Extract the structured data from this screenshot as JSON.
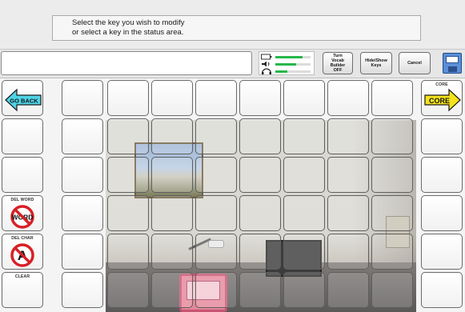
{
  "message": {
    "line1": "Select the key you wish to modify",
    "line2": "or select a key in the status area."
  },
  "status_bar": {
    "text_field_value": "",
    "meters": [
      {
        "icon": "battery-icon",
        "color": "#26b84a",
        "fill_fraction": 0.78
      },
      {
        "icon": "speaker-volume-icon",
        "color": "#26b84a",
        "fill_fraction": 0.6
      },
      {
        "icon": "headphones-icon",
        "color": "#26b84a",
        "fill_fraction": 0.35
      }
    ],
    "vocab_builder_button": [
      "Turn",
      "Vocab",
      "Builder",
      "OFF"
    ],
    "hide_show_keys_button": [
      "Hide/Show",
      "Keys"
    ],
    "cancel_button": "Cancel",
    "save_icon": "floppy-disk-icon"
  },
  "keys": {
    "go_back": {
      "label": "GO BACK",
      "arrow_color": "#4fd4e6",
      "direction": "left"
    },
    "core": {
      "caption": "CORE",
      "label": "CORE",
      "arrow_color": "#f5e21c",
      "direction": "right"
    },
    "del_word": {
      "caption": "DEL WORD",
      "symbol_text": "WORD"
    },
    "del_char": {
      "caption": "DEL CHAR",
      "symbol_text": "A"
    },
    "clear": {
      "caption": "CLEAR"
    }
  },
  "colors": {
    "no_sign_red": "#d81f26",
    "key_border": "#6b6b6b"
  }
}
